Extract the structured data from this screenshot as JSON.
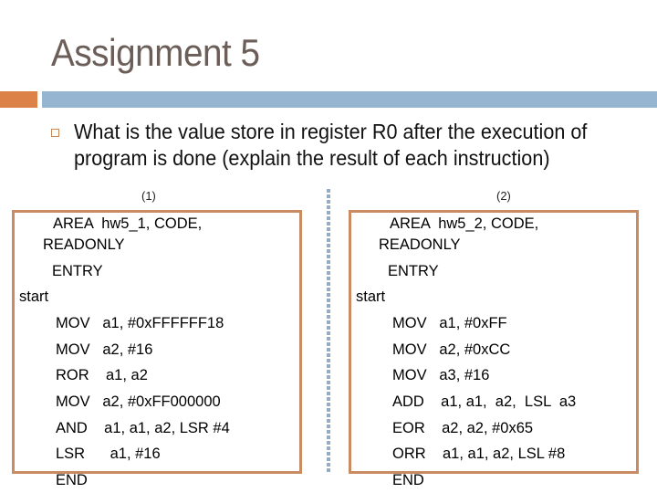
{
  "slide": {
    "title": "Assignment 5",
    "question": "What is the value store in register R0 after the execution of program is done  (explain the result of each instruction)",
    "colors": {
      "title": "#6b5d57",
      "accent_orange": "#dc8249",
      "accent_blue": "#95b5d1",
      "box_border": "#c98c62"
    }
  },
  "programs": [
    {
      "label": "(1)",
      "lines": [
        "AREA  hw5_1, CODE,",
        "READONLY",
        "ENTRY",
        "start",
        "MOV   a1, #0xFFFFFF18",
        "MOV   a2, #16",
        "ROR    a1, a2",
        "MOV   a2, #0xFF000000",
        "AND    a1, a1, a2, LSR #4",
        "LSR      a1, #16",
        "END"
      ]
    },
    {
      "label": "(2)",
      "lines": [
        "AREA  hw5_2, CODE,",
        "READONLY",
        "ENTRY",
        "start",
        "MOV   a1, #0xFF",
        "MOV   a2, #0xCC",
        "MOV   a3, #16",
        "ADD    a1, a1,  a2,  LSL  a3",
        "EOR    a2, a2, #0x65",
        "ORR    a1, a1, a2, LSL #8",
        "END"
      ]
    }
  ]
}
